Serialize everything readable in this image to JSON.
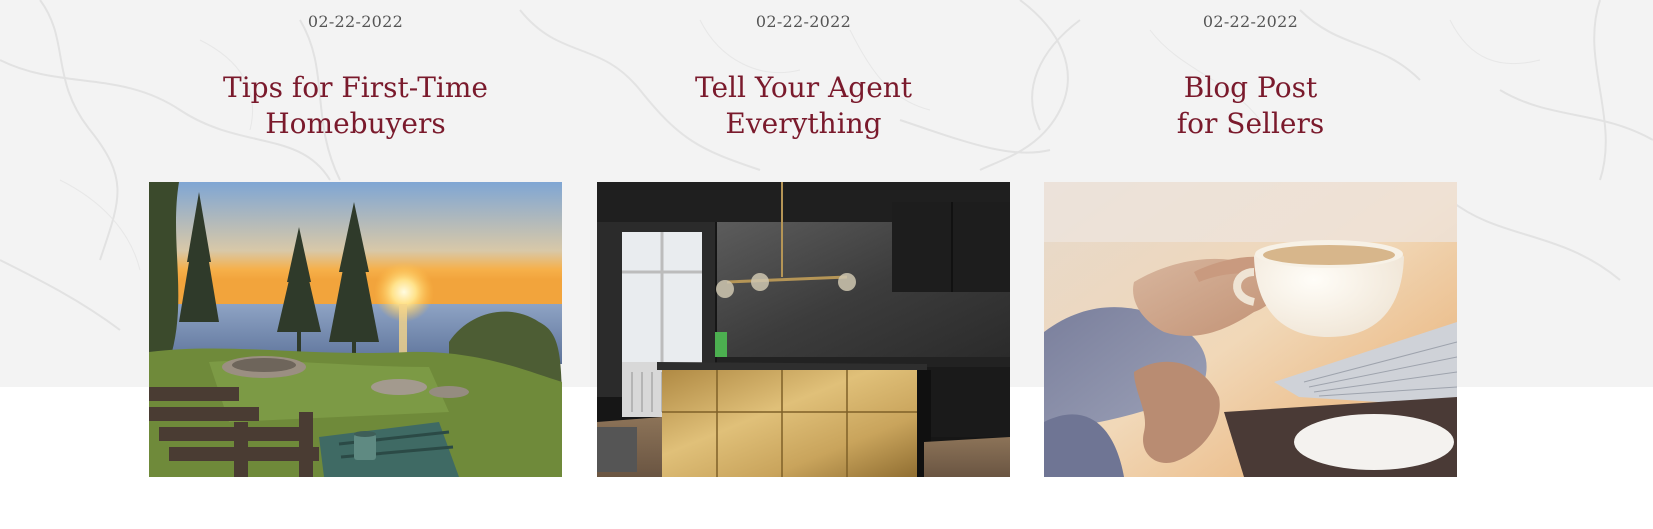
{
  "posts": [
    {
      "date": "02-22-2022",
      "title_line1": "Tips for First-Time",
      "title_line2": "Homebuyers",
      "image": "lakeside-sunset-photo"
    },
    {
      "date": "02-22-2022",
      "title_line1": "Tell Your Agent",
      "title_line2": "Everything",
      "image": "modern-kitchen-photo"
    },
    {
      "date": "02-22-2022",
      "title_line1": "Blog Post",
      "title_line2": "for Sellers",
      "image": "coffee-cup-laptop-photo"
    }
  ],
  "colors": {
    "title": "#7a1a2c",
    "date": "#555555",
    "marble_background": "#f3f3f3"
  }
}
